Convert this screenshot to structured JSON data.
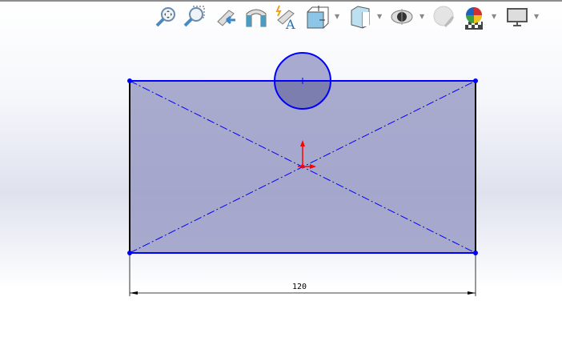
{
  "toolbar": {
    "items": [
      {
        "name": "zoom-to-fit-icon"
      },
      {
        "name": "zoom-to-area-icon"
      },
      {
        "name": "previous-view-icon"
      },
      {
        "name": "section-view-icon"
      },
      {
        "name": "dynamic-annotation-views-icon"
      },
      {
        "name": "view-orientation-icon",
        "dropdown": true
      },
      {
        "name": "display-style-icon",
        "dropdown": true
      },
      {
        "name": "hide-show-items-icon",
        "dropdown": true
      },
      {
        "name": "edit-appearance-icon"
      },
      {
        "name": "apply-scene-icon",
        "dropdown": true
      },
      {
        "name": "view-settings-icon",
        "dropdown": true
      }
    ]
  },
  "sketch": {
    "dimension_label": "120",
    "colors": {
      "line": "#0000ff",
      "fill": "#9a9cc6",
      "origin": "#ff0000"
    }
  }
}
